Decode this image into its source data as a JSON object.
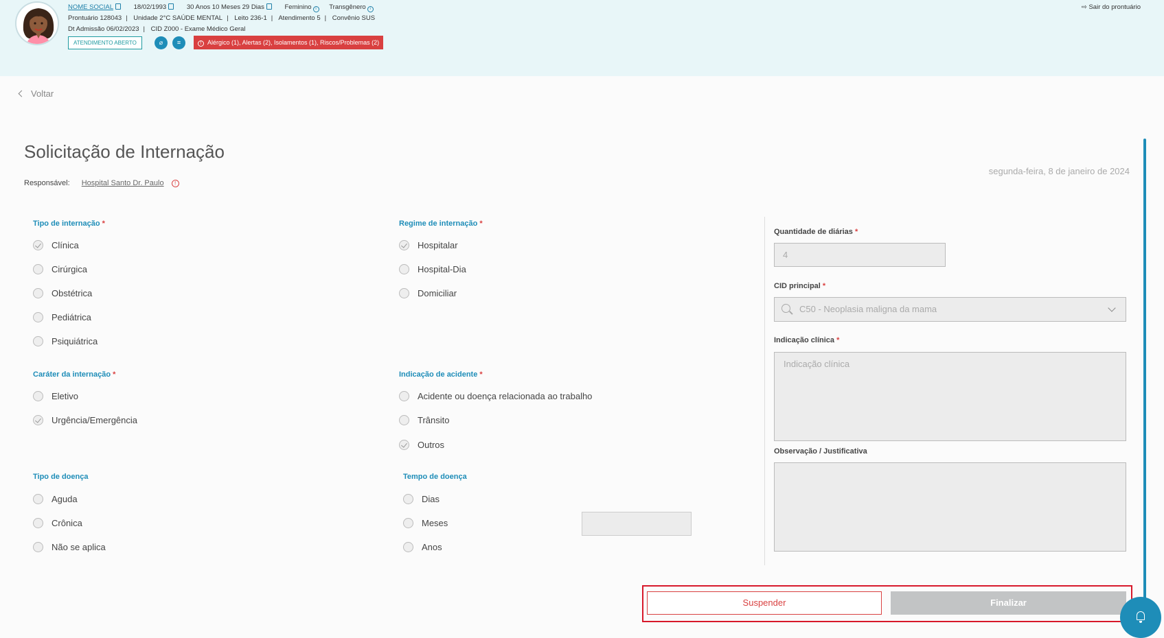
{
  "header": {
    "social_name": "NOME SOCIAL",
    "birth_date": "18/02/1993",
    "age": "30 Anos 10 Meses 29 Dias",
    "sex": "Feminino",
    "gender": "Transgênero",
    "prontuario": "Prontuário 128043",
    "unidade": "Unidade 2°C SAÚDE MENTAL",
    "leito": "Leito 236-1",
    "atendimento": "Atendimento 5",
    "convenio": "Convênio SUS",
    "admissao": "Dt Admissão 06/02/2023",
    "cid": "CID Z000 - Exame Médico Geral",
    "status_badge": "ATENDIMENTO ABERTO",
    "alerts": "Alérgico (1),  Alertas (2),  Isolamentos (1),  Riscos/Problemas (2)",
    "exit_label": "Sair do prontuário"
  },
  "nav": {
    "back_label": "Voltar"
  },
  "page": {
    "title": "Solicitação de Internação",
    "responsavel_label": "Responsável:",
    "responsavel_name": "Hospital Santo Dr. Paulo",
    "date": "segunda-feira, 8 de janeiro de 2024"
  },
  "form": {
    "tipo_internacao": {
      "label": "Tipo de internação",
      "options": [
        "Clínica",
        "Cirúrgica",
        "Obstétrica",
        "Pediátrica",
        "Psiquiátrica"
      ],
      "selected": "Clínica"
    },
    "regime_internacao": {
      "label": "Regime de internação",
      "options": [
        "Hospitalar",
        "Hospital-Dia",
        "Domiciliar"
      ],
      "selected": "Hospitalar"
    },
    "carater_internacao": {
      "label": "Caráter da internação",
      "options": [
        "Eletivo",
        "Urgência/Emergência"
      ],
      "selected": "Urgência/Emergência"
    },
    "indicacao_acidente": {
      "label": "Indicação de acidente",
      "options": [
        "Acidente ou doença relacionada ao trabalho",
        "Trânsito",
        "Outros"
      ],
      "selected": "Outros"
    },
    "tipo_doenca": {
      "label": "Tipo de doença",
      "options": [
        "Aguda",
        "Crônica",
        "Não se aplica"
      ]
    },
    "tempo_doenca": {
      "label": "Tempo de doença",
      "options": [
        "Dias",
        "Meses",
        "Anos"
      ]
    },
    "quantidade_diarias": {
      "label": "Quantidade de diárias",
      "value": "4"
    },
    "cid_principal": {
      "label": "CID principal",
      "value": "C50 - Neoplasia maligna da mama"
    },
    "indicacao_clinica": {
      "label": "Indicação clínica",
      "placeholder": "Indicação clínica"
    },
    "observacao": {
      "label": "Observação / Justificativa"
    },
    "required_mark": "*"
  },
  "actions": {
    "suspend_label": "Suspender",
    "finish_label": "Finalizar"
  },
  "colors": {
    "accent": "#1e8db8",
    "danger": "#d94040",
    "header_bg": "#e8f6f8"
  }
}
